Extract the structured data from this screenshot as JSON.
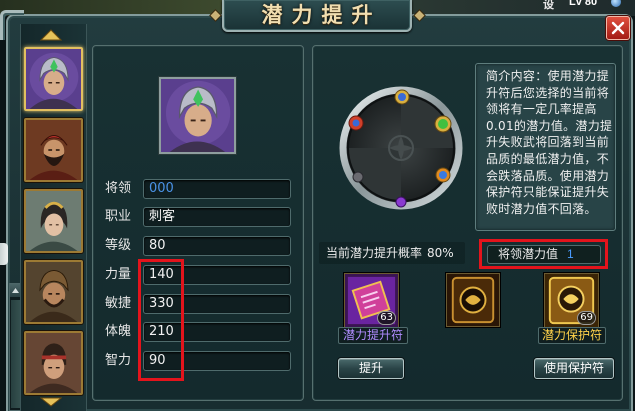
{
  "window": {
    "title": "潜力提升"
  },
  "hud": {
    "settings_label": "设",
    "level": "Lv 80"
  },
  "icons": {
    "close": "close-icon",
    "list_up": "arrow-up-icon",
    "list_down": "arrow-down-icon",
    "scroll_up": "arrow-up-icon",
    "dial": "potential-dial-icon"
  },
  "general": {
    "rows": [
      {
        "label": "将领",
        "value": "000"
      },
      {
        "label": "职业",
        "value": "刺客"
      },
      {
        "label": "等级",
        "value": "80"
      },
      {
        "label": "力量",
        "value": "140"
      },
      {
        "label": "敏捷",
        "value": "330"
      },
      {
        "label": "体魄",
        "value": "210"
      },
      {
        "label": "智力",
        "value": "90"
      }
    ]
  },
  "upgrade": {
    "intro_lines": [
      "简介内容：使用潜力提",
      "升符后您选择的当前将",
      "领将有一定几率提高",
      "0.01的潜力值。潜力提",
      "升失败武将回落到当前",
      "品质的最低潜力值，不",
      "会跌落品质。使用潜力",
      "保护符只能保证提升失",
      "败时潜力值不回落。"
    ],
    "probability_label": "当前潜力提升概率",
    "probability_value": "80%",
    "potential_label": "将领潜力值",
    "potential_value": "1",
    "items": [
      {
        "name": "潜力提升符",
        "count": "63",
        "icon": "purple-scroll-icon"
      },
      {
        "icon": "gold-seal-icon"
      },
      {
        "name": "潜力保护符",
        "count": "69",
        "icon": "gold-scroll-icon"
      }
    ],
    "buttons": {
      "upgrade": "提升",
      "use_protect": "使用保护符"
    }
  },
  "colors": {
    "highlight": "#e3141c",
    "name_value": "#4a92e6",
    "potential_value": "#4a9cff",
    "upgrade_item_label": "#b08cff",
    "protect_item_label": "#ffd24a",
    "title": "#f1deb0"
  }
}
